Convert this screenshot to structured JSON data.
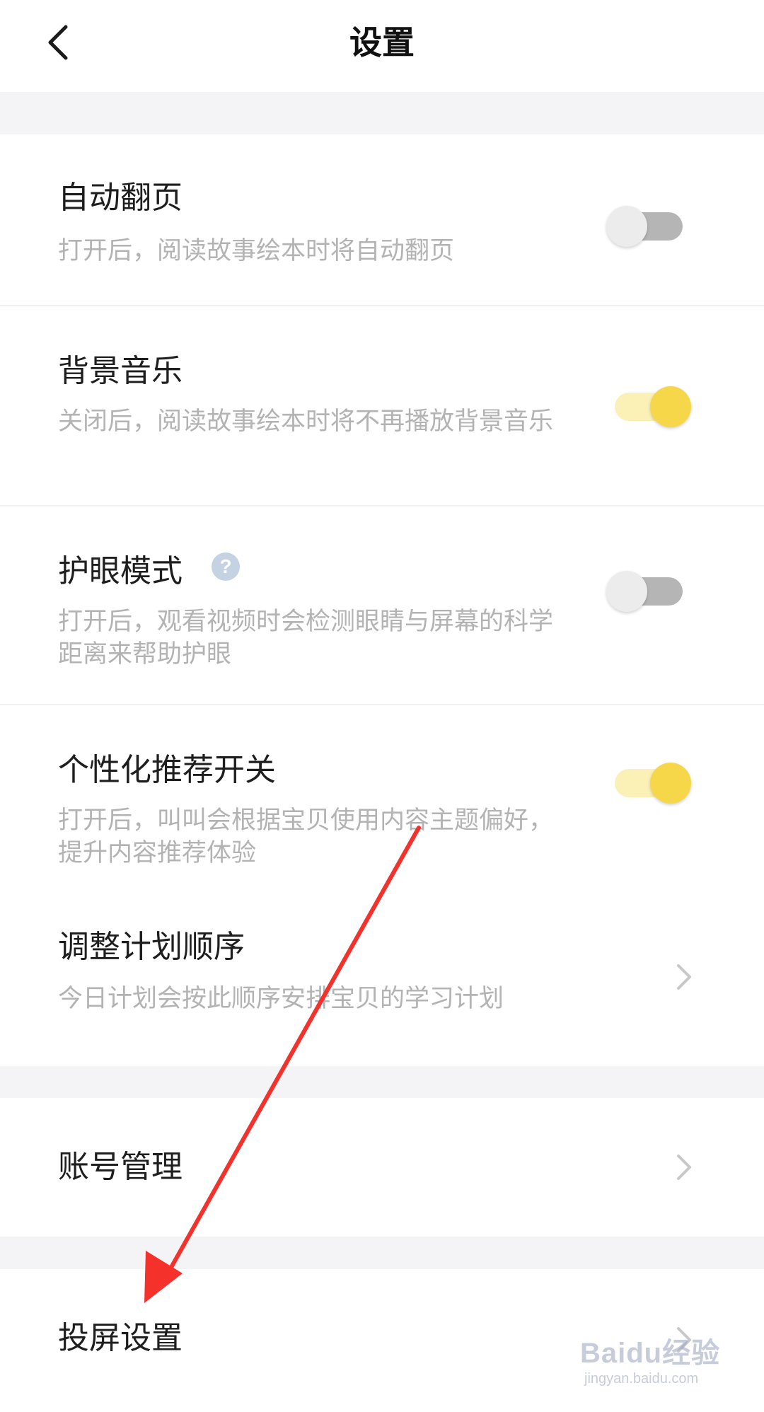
{
  "header": {
    "title": "设置",
    "back_icon": "chevron-left-icon"
  },
  "settings": {
    "auto_page": {
      "title": "自动翻页",
      "desc": "打开后，阅读故事绘本时将自动翻页",
      "enabled": false
    },
    "bg_music": {
      "title": "背景音乐",
      "desc": "关闭后，阅读故事绘本时将不再播放背景音乐",
      "enabled": true
    },
    "eye_care": {
      "title": "护眼模式",
      "help_icon": "question-circle-icon",
      "desc": "打开后，观看视频时会检测眼睛与屏幕的科学距离来帮助护眼",
      "enabled": false
    },
    "personalized": {
      "title": "个性化推荐开关",
      "desc": "打开后，叫叫会根据宝贝使用内容主题偏好，提升内容推荐体验",
      "enabled": true
    },
    "plan_order": {
      "title": "调整计划顺序",
      "desc": "今日计划会按此顺序安排宝贝的学习计划"
    }
  },
  "account": {
    "title": "账号管理"
  },
  "cast": {
    "title": "投屏设置"
  },
  "watermark": {
    "brand": "Baidu经验",
    "url": "jingyan.baidu.com"
  },
  "colors": {
    "toggle_on_knob": "#f7d74a",
    "toggle_on_track": "#fbf1b7",
    "toggle_off_track": "#b5b5b5",
    "annotation_arrow": "#f4312b"
  }
}
